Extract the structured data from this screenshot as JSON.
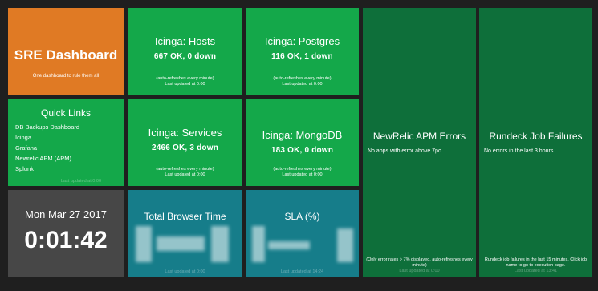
{
  "header": {
    "title": "SRE Dashboard",
    "subtitle": "One dashboard to rule them all"
  },
  "tiles": {
    "hosts": {
      "title": "Icinga: Hosts",
      "status": "667 OK, 0 down",
      "refresh": "(auto-refreshes every minute)",
      "updated": "Last updated at 0:00"
    },
    "postgres": {
      "title": "Icinga: Postgres",
      "status": "116 OK, 1 down",
      "refresh": "(auto-refreshes every minute)",
      "updated": "Last updated at 0:00"
    },
    "services": {
      "title": "Icinga: Services",
      "status": "2466 OK, 3 down",
      "refresh": "(auto-refreshes every minute)",
      "updated": "Last updated at 0:00"
    },
    "mongodb": {
      "title": "Icinga: MongoDB",
      "status": "183 OK, 0 down",
      "refresh": "(auto-refreshes every minute)",
      "updated": "Last updated at 0:00"
    },
    "newrelic": {
      "title": "NewRelic APM Errors",
      "message": "No apps with error above 7pc",
      "note": "(Only error rates > 7% displayed, auto-refreshes every minute)",
      "updated": "Last updated at 0:00"
    },
    "rundeck": {
      "title": "Rundeck Job Failures",
      "message": "No errors in the last 3 hours",
      "note": "Rundeck job failures in the last 15 minutes. Click job name to go to execution page.",
      "updated": "Last updated at 13:41"
    },
    "browser": {
      "title": "Total Browser Time",
      "updated": "Last updated at 0:00"
    },
    "sla": {
      "title": "SLA (%)",
      "updated": "Last updated at 14:24"
    }
  },
  "quick_links": {
    "title": "Quick Links",
    "links": [
      "DB Backups Dashboard",
      "Icinga",
      "Grafana",
      "Newrelic APM (APM)",
      "Splunk"
    ],
    "updated": "Last updated at 0:00"
  },
  "clock": {
    "date": "Mon Mar 27 2017",
    "time": "0:01:42"
  }
}
